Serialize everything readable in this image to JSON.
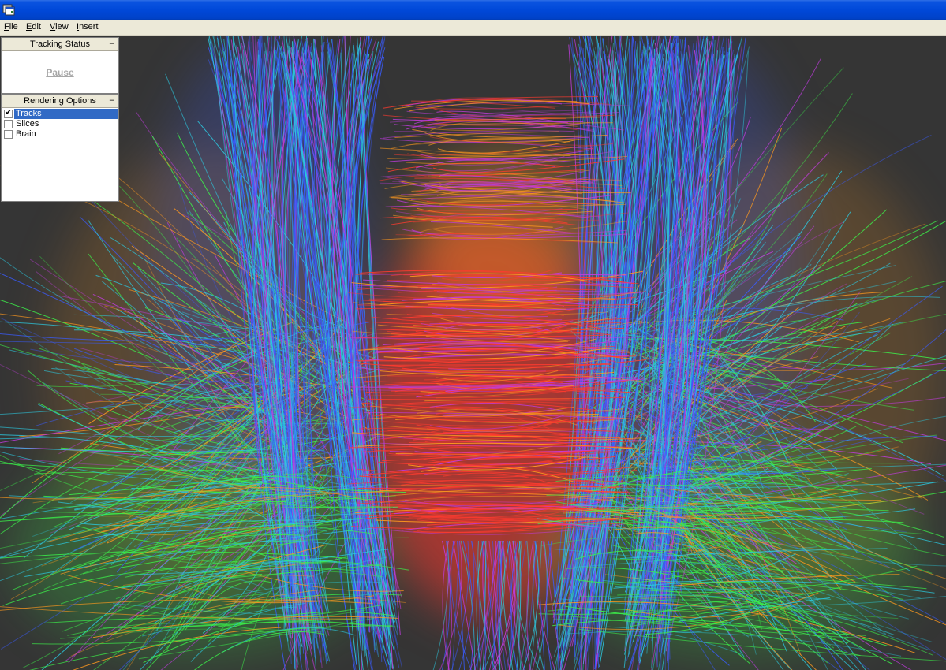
{
  "window": {
    "title": "",
    "icon": "app-window-icon"
  },
  "menu": [
    {
      "label": "File",
      "accelerator": "F"
    },
    {
      "label": "Edit",
      "accelerator": "E"
    },
    {
      "label": "View",
      "accelerator": "V"
    },
    {
      "label": "Insert",
      "accelerator": "I"
    }
  ],
  "tracking_panel": {
    "title": "Tracking Status",
    "collapse_label": "–",
    "pause_label": "Pause"
  },
  "rendering_panel": {
    "title": "Rendering Options",
    "collapse_label": "–",
    "options": [
      {
        "label": "Tracks",
        "checked": true,
        "selected": true
      },
      {
        "label": "Slices",
        "checked": false,
        "selected": false
      },
      {
        "label": "Brain",
        "checked": false,
        "selected": false
      }
    ]
  },
  "viewport": {
    "content": "tractography-fibers",
    "background": "#353535",
    "colors": {
      "left_right": "#ff3b2f",
      "anterior_posterior": "#3cf24a",
      "superior_inferior": "#3a5cff",
      "mixed_orange": "#ff9a1f",
      "mixed_cyan": "#2cc9e0",
      "mixed_magenta": "#c23ce0"
    }
  }
}
